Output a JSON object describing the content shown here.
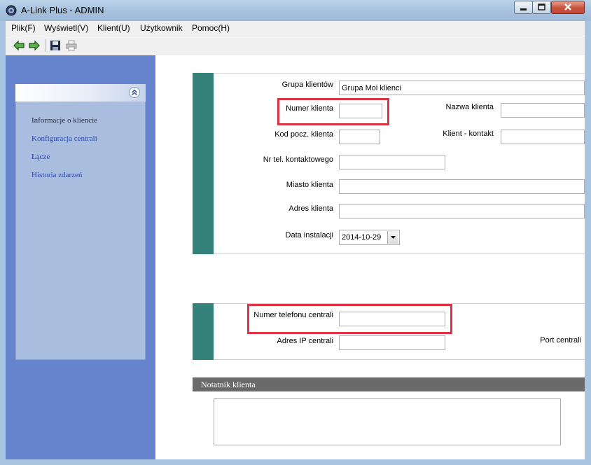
{
  "window": {
    "title": "A-Link Plus - ADMIN"
  },
  "menu": [
    {
      "label": "Plik(F)"
    },
    {
      "label": "Wyświetl(V)"
    },
    {
      "label": "Klient(U)"
    },
    {
      "label": "Użytkownik"
    },
    {
      "label": "Pomoc(H)"
    }
  ],
  "toolbar": {
    "icons": [
      "back-arrow-icon",
      "forward-arrow-icon",
      "save-icon",
      "print-icon"
    ]
  },
  "sidebar": {
    "items": [
      {
        "label": "Informacje o kliencie",
        "active": true
      },
      {
        "label": "Konfiguracja centrali",
        "active": false
      },
      {
        "label": "Łącze",
        "active": false
      },
      {
        "label": "Historia zdarzeń",
        "active": false
      }
    ]
  },
  "client_form": {
    "group_label": "Grupa klientów",
    "group_value": "Grupa Moi klienci",
    "number_label": "Numer klienta",
    "number_value": "",
    "name_label": "Nazwa klienta",
    "name_value": "",
    "postal_label": "Kod pocz. klienta",
    "postal_value": "",
    "contact_label": "Klient - kontakt",
    "contact_value": "",
    "phone_label": "Nr tel. kontaktowego",
    "phone_value": "",
    "city_label": "Miasto klienta",
    "city_value": "",
    "address_label": "Adres klienta",
    "address_value": "",
    "install_date_label": "Data instalacji",
    "install_date_value": "2014-10-29"
  },
  "panel_form": {
    "panel_phone_label": "Numer telefonu centrali",
    "panel_phone_value": "",
    "ip_label": "Adres IP centrali",
    "ip_value": "",
    "port_label": "Port centrali"
  },
  "notes": {
    "title": "Notatnik klienta",
    "value": ""
  },
  "colors": {
    "sidebar_bg": "#6683cd",
    "panel_bg": "#a9bedf",
    "accent_teal": "#348279",
    "highlight_red": "#dd3445",
    "link_blue": "#2a46a8"
  }
}
